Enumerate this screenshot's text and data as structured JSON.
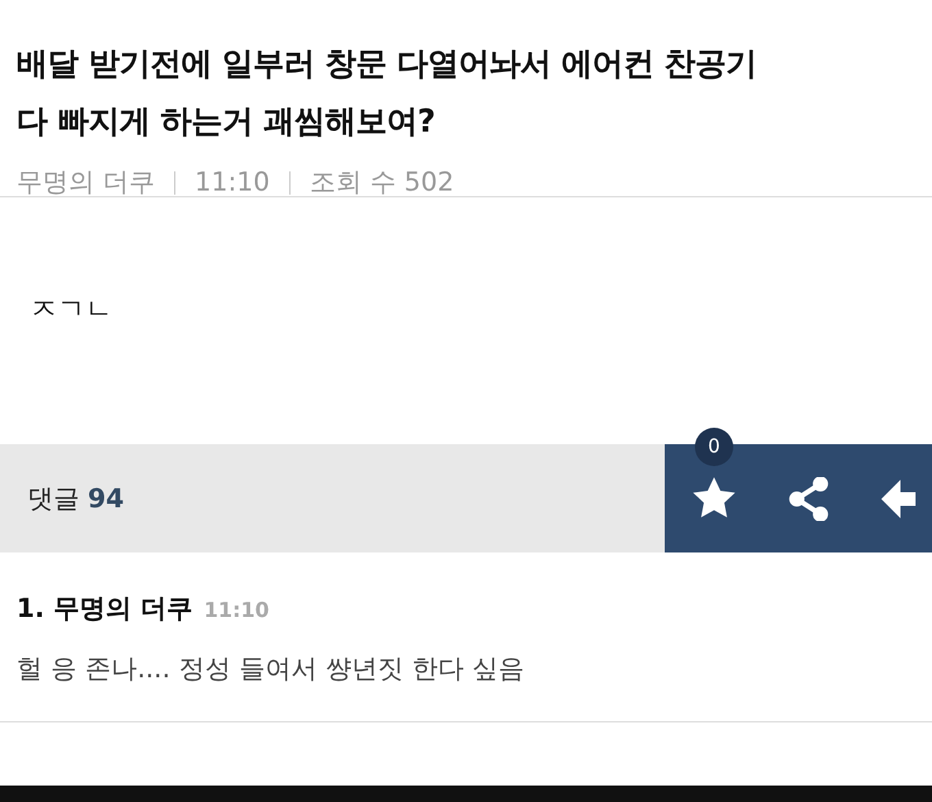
{
  "post": {
    "title": "배달 받기전에 일부러 창문 다열어놔서 에어컨 찬공기 다 빠지게 하는거 괘씸해보여?",
    "author": "무명의 더쿠",
    "time": "11:10",
    "views": "조회 수 502",
    "body": "ㅈㄱㄴ"
  },
  "comment_bar": {
    "label": "댓글",
    "count": "94",
    "favorite_count": "0"
  },
  "comments": [
    {
      "number": "1.",
      "author": "무명의 더쿠",
      "time": "11:10",
      "text": "헐 응 존나.... 정성 들여서 썅년짓 한다 싶음"
    }
  ]
}
